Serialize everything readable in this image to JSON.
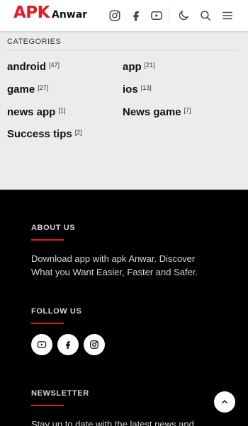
{
  "header": {
    "logo_primary": "APK",
    "logo_secondary": "Anwar",
    "icons": [
      "instagram-icon",
      "facebook-icon",
      "youtube-icon",
      "dark-mode-icon",
      "search-icon",
      "menu-icon"
    ]
  },
  "categories": {
    "title": "CATEGORIES",
    "items": [
      {
        "name": "android",
        "count": "[47]"
      },
      {
        "name": "app",
        "count": "[21]"
      },
      {
        "name": "game",
        "count": "[27]"
      },
      {
        "name": "ios",
        "count": "[13]"
      },
      {
        "name": "news app",
        "count": "[1]"
      },
      {
        "name": "News game",
        "count": "[7]"
      },
      {
        "name": "Success tips",
        "count": "[2]"
      }
    ]
  },
  "footer": {
    "about": {
      "title": "ABOUT US",
      "text": "Download app with apk Anwar. Discover What you Want Easier, Faster and Safer."
    },
    "follow": {
      "title": "FOLLOW US",
      "icons": [
        "youtube-icon",
        "facebook-icon",
        "instagram-icon"
      ]
    },
    "newsletter": {
      "title": "NEWSLETTER",
      "text": "Stay up to date with the latest news and"
    }
  },
  "back_to_top": {
    "icon": "chevron-up-icon"
  },
  "colors": {
    "brand": "#e21b23",
    "footer_bg": "#000000",
    "page_bg": "#ececec"
  }
}
